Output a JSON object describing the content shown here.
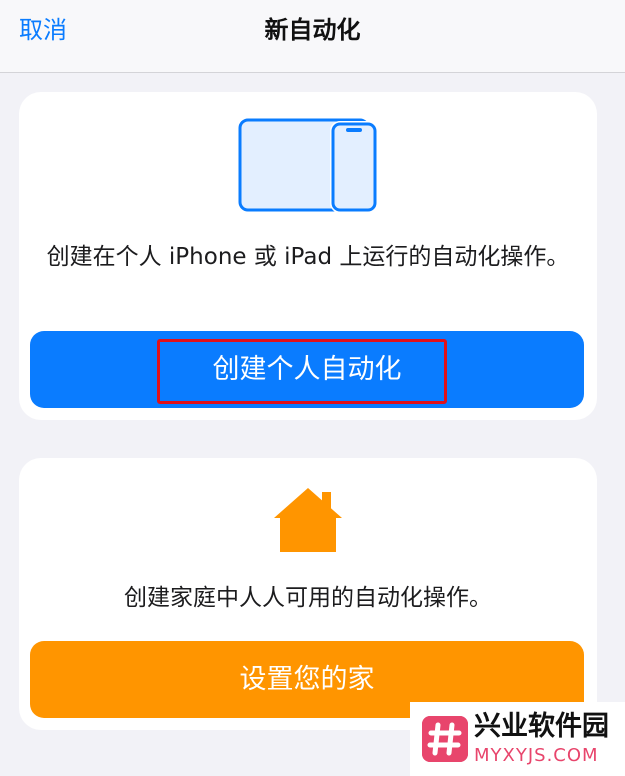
{
  "nav": {
    "cancel_label": "取消",
    "title": "新自动化"
  },
  "personal": {
    "icon": "ipad-iphone-icon",
    "description": "创建在个人 iPhone 或 iPad 上运行的自动化操作。",
    "button_label": "创建个人自动化"
  },
  "home": {
    "icon": "house-icon",
    "description": "创建家庭中人人可用的自动化操作。",
    "button_label": "设置您的家"
  },
  "watermark": {
    "title": "兴业软件园",
    "subtitle": "MYXYJS.COM"
  },
  "colors": {
    "accent_blue": "#0a7cff",
    "accent_orange": "#ff9500",
    "highlight_red": "#e0101a",
    "watermark_pink": "#e8456c"
  }
}
